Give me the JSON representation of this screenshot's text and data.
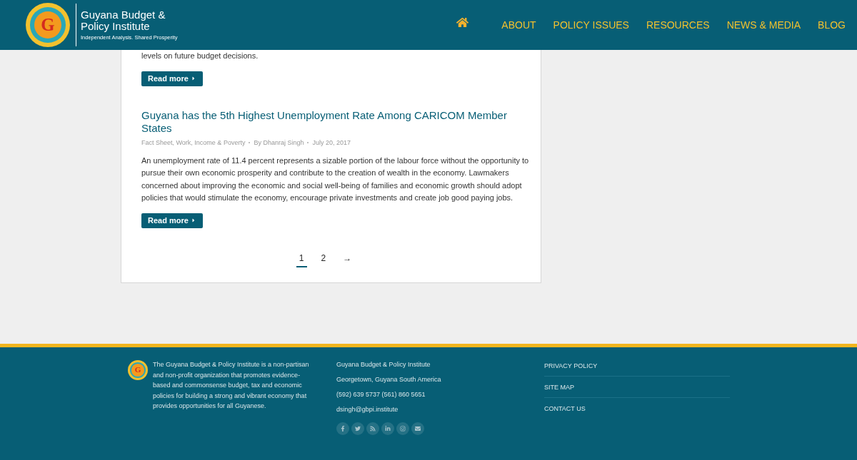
{
  "header": {
    "logo_letter": "G",
    "title_line_1": "Guyana Budget &",
    "title_line_2": "Policy Institute",
    "tagline": "Independent Analysis. Shared Prosperity",
    "nav": [
      "ABOUT",
      "POLICY ISSUES",
      "RESOURCES",
      "NEWS & MEDIA",
      "BLOG"
    ]
  },
  "posts": [
    {
      "excerpt": "levels on future budget decisions.",
      "button": "Read more"
    },
    {
      "title": "Guyana has the 5th Highest Unemployment Rate Among CARICOM Member States",
      "categories": "Fact Sheet, Work, Income & Poverty",
      "author": "By Dhanraj Singh",
      "date": "July 20, 2017",
      "excerpt": "An unemployment rate of 11.4 percent represents a sizable portion of the labour force without the opportunity to pursue their own economic prosperity and contribute to the creation of wealth in the economy. Lawmakers concerned about improving the economic and social well-being of families and economic growth should adopt policies that would stimulate the economy, encourage private investments and create job good paying jobs.",
      "button": "Read more"
    }
  ],
  "pagination": {
    "pages": [
      {
        "label": "1",
        "selected": true
      },
      {
        "label": "2",
        "selected": false
      }
    ],
    "next": "→"
  },
  "footer": {
    "logo_letter": "G",
    "about": "The Guyana Budget & Policy Institute is a non-partisan and non-profit organization that promotes evidence-based and commonsense budget, tax and economic policies for building a strong and vibrant economy that provides opportunities for all Guyanese.",
    "contact": [
      "Guyana Budget & Policy Institute",
      "Georgetown, Guyana South America",
      "(592) 639 5737 (561) 860 5651",
      "dsingh@gbpi.institute"
    ],
    "links": [
      "PRIVACY POLICY",
      "SITE MAP",
      "CONTACT US"
    ]
  }
}
